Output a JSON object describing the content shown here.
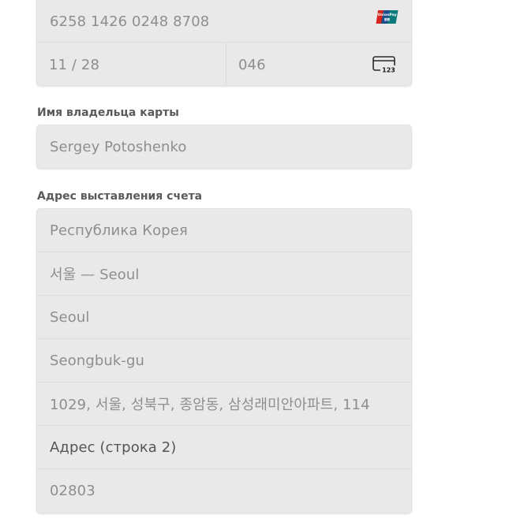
{
  "card": {
    "number": "6258 1426 0248 8708",
    "expiry": "11 / 28",
    "cvc": "046",
    "brand_icon": "unionpay-icon",
    "cvc_icon": "card-cvc-icon",
    "brand_text": "UnionPay",
    "cvc_icon_text": "123"
  },
  "cardholder": {
    "label": "Имя владельца карты",
    "value": "Sergey Potoshenko"
  },
  "billing": {
    "label": "Адрес выставления счета",
    "fields": [
      {
        "value": "Республика Корея",
        "placeholder": false
      },
      {
        "value": "서울 — Seoul",
        "placeholder": false
      },
      {
        "value": "Seoul",
        "placeholder": false
      },
      {
        "value": "Seongbuk-gu",
        "placeholder": false
      },
      {
        "value": "1029, 서울, 성북구, 종암동, 삼성래미안아파트, 114",
        "placeholder": false
      },
      {
        "value": "Адрес (строка 2)",
        "placeholder": true
      },
      {
        "value": "02803",
        "placeholder": false
      }
    ]
  },
  "colors": {
    "field_bg": "#e9e9e9",
    "value_text": "#8e8e8e",
    "placeholder_text": "#555555",
    "label_text": "#5a5a5a",
    "unionpay_red": "#d7261e",
    "unionpay_blue": "#1b4c8c",
    "unionpay_teal": "#0a7a7a"
  }
}
